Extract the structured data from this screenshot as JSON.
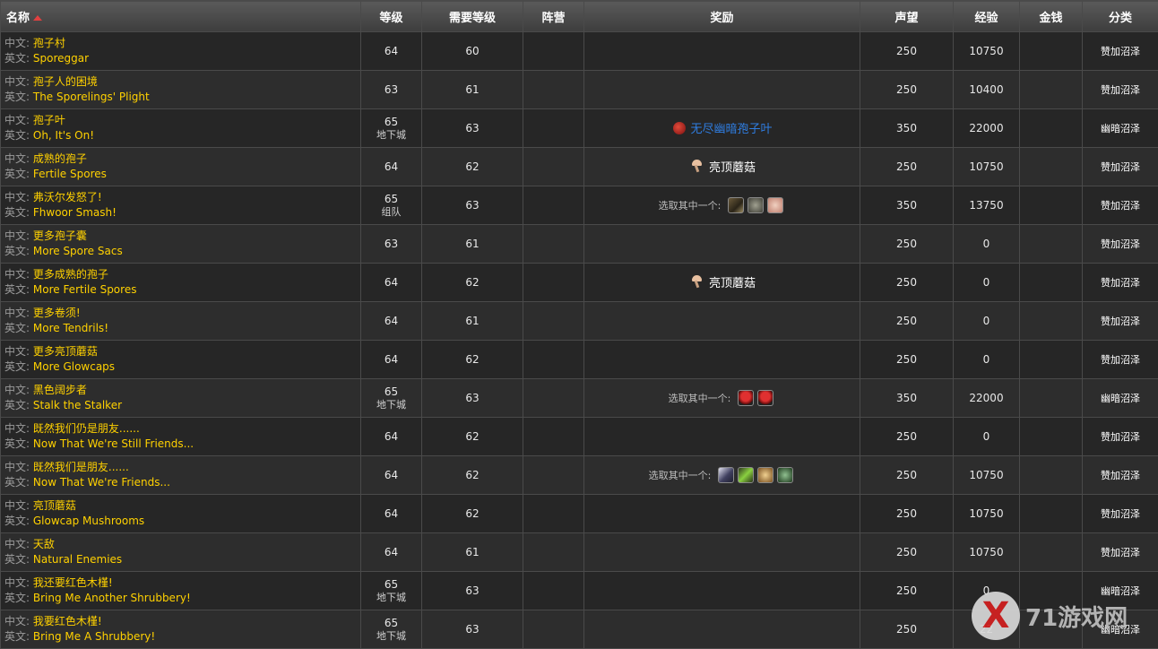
{
  "headers": {
    "name": "名称",
    "level": "等级",
    "req_level": "需要等级",
    "faction": "阵营",
    "reward": "奖励",
    "reputation": "声望",
    "experience": "经验",
    "money": "金钱",
    "category": "分类"
  },
  "labels": {
    "cn": "中文:",
    "en": "英文:",
    "choose_one": "选取其中一个:"
  },
  "rows": [
    {
      "cn": "孢子村",
      "en": "Sporeggar",
      "level": "64",
      "sub": "",
      "req": "60",
      "rep": "250",
      "xp": "10750",
      "cat": "赞加沼泽"
    },
    {
      "cn": "孢子人的困境",
      "en": "The Sporelings' Plight",
      "level": "63",
      "sub": "",
      "req": "61",
      "rep": "250",
      "xp": "10400",
      "cat": "赞加沼泽"
    },
    {
      "cn": "孢子叶",
      "en": "Oh, It's On!",
      "level": "65",
      "sub": "地下城",
      "req": "63",
      "rep": "350",
      "xp": "22000",
      "cat": "幽暗沼泽",
      "reward_item": "无尽幽暗孢子叶"
    },
    {
      "cn": "成熟的孢子",
      "en": "Fertile Spores",
      "level": "64",
      "sub": "",
      "req": "62",
      "rep": "250",
      "xp": "10750",
      "cat": "赞加沼泽",
      "reward_item": "亮顶蘑菇"
    },
    {
      "cn": "弗沃尔发怒了!",
      "en": "Fhwoor Smash!",
      "level": "65",
      "sub": "组队",
      "req": "63",
      "rep": "350",
      "xp": "13750",
      "cat": "赞加沼泽"
    },
    {
      "cn": "更多孢子囊",
      "en": "More Spore Sacs",
      "level": "63",
      "sub": "",
      "req": "61",
      "rep": "250",
      "xp": "0",
      "cat": "赞加沼泽"
    },
    {
      "cn": "更多成熟的孢子",
      "en": "More Fertile Spores",
      "level": "64",
      "sub": "",
      "req": "62",
      "rep": "250",
      "xp": "0",
      "cat": "赞加沼泽",
      "reward_item": "亮顶蘑菇"
    },
    {
      "cn": "更多卷须!",
      "en": "More Tendrils!",
      "level": "64",
      "sub": "",
      "req": "61",
      "rep": "250",
      "xp": "0",
      "cat": "赞加沼泽"
    },
    {
      "cn": "更多亮顶蘑菇",
      "en": "More Glowcaps",
      "level": "64",
      "sub": "",
      "req": "62",
      "rep": "250",
      "xp": "0",
      "cat": "赞加沼泽"
    },
    {
      "cn": "黑色阔步者",
      "en": "Stalk the Stalker",
      "level": "65",
      "sub": "地下城",
      "req": "63",
      "rep": "350",
      "xp": "22000",
      "cat": "幽暗沼泽"
    },
    {
      "cn": "既然我们仍是朋友......",
      "en": "Now That We're Still Friends...",
      "level": "64",
      "sub": "",
      "req": "62",
      "rep": "250",
      "xp": "0",
      "cat": "赞加沼泽"
    },
    {
      "cn": "既然我们是朋友......",
      "en": "Now That We're Friends...",
      "level": "64",
      "sub": "",
      "req": "62",
      "rep": "250",
      "xp": "10750",
      "cat": "赞加沼泽"
    },
    {
      "cn": "亮顶蘑菇",
      "en": "Glowcap Mushrooms",
      "level": "64",
      "sub": "",
      "req": "62",
      "rep": "250",
      "xp": "10750",
      "cat": "赞加沼泽"
    },
    {
      "cn": "天敌",
      "en": "Natural Enemies",
      "level": "64",
      "sub": "",
      "req": "61",
      "rep": "250",
      "xp": "10750",
      "cat": "赞加沼泽"
    },
    {
      "cn": "我还要红色木槿!",
      "en": "Bring Me Another Shrubbery!",
      "level": "65",
      "sub": "地下城",
      "req": "63",
      "rep": "250",
      "xp": "0",
      "cat": "幽暗沼泽"
    },
    {
      "cn": "我要红色木槿!",
      "en": "Bring Me A Shrubbery!",
      "level": "65",
      "sub": "地下城",
      "req": "63",
      "rep": "250",
      "xp": "22",
      "cat": "幽暗沼泽"
    }
  ],
  "colors": {
    "quest_name": "#ffd100",
    "rare_item": "#2f7de1",
    "header_bg": "#4a4a4a"
  },
  "watermark": {
    "logo": "X",
    "text": "71游戏网"
  }
}
